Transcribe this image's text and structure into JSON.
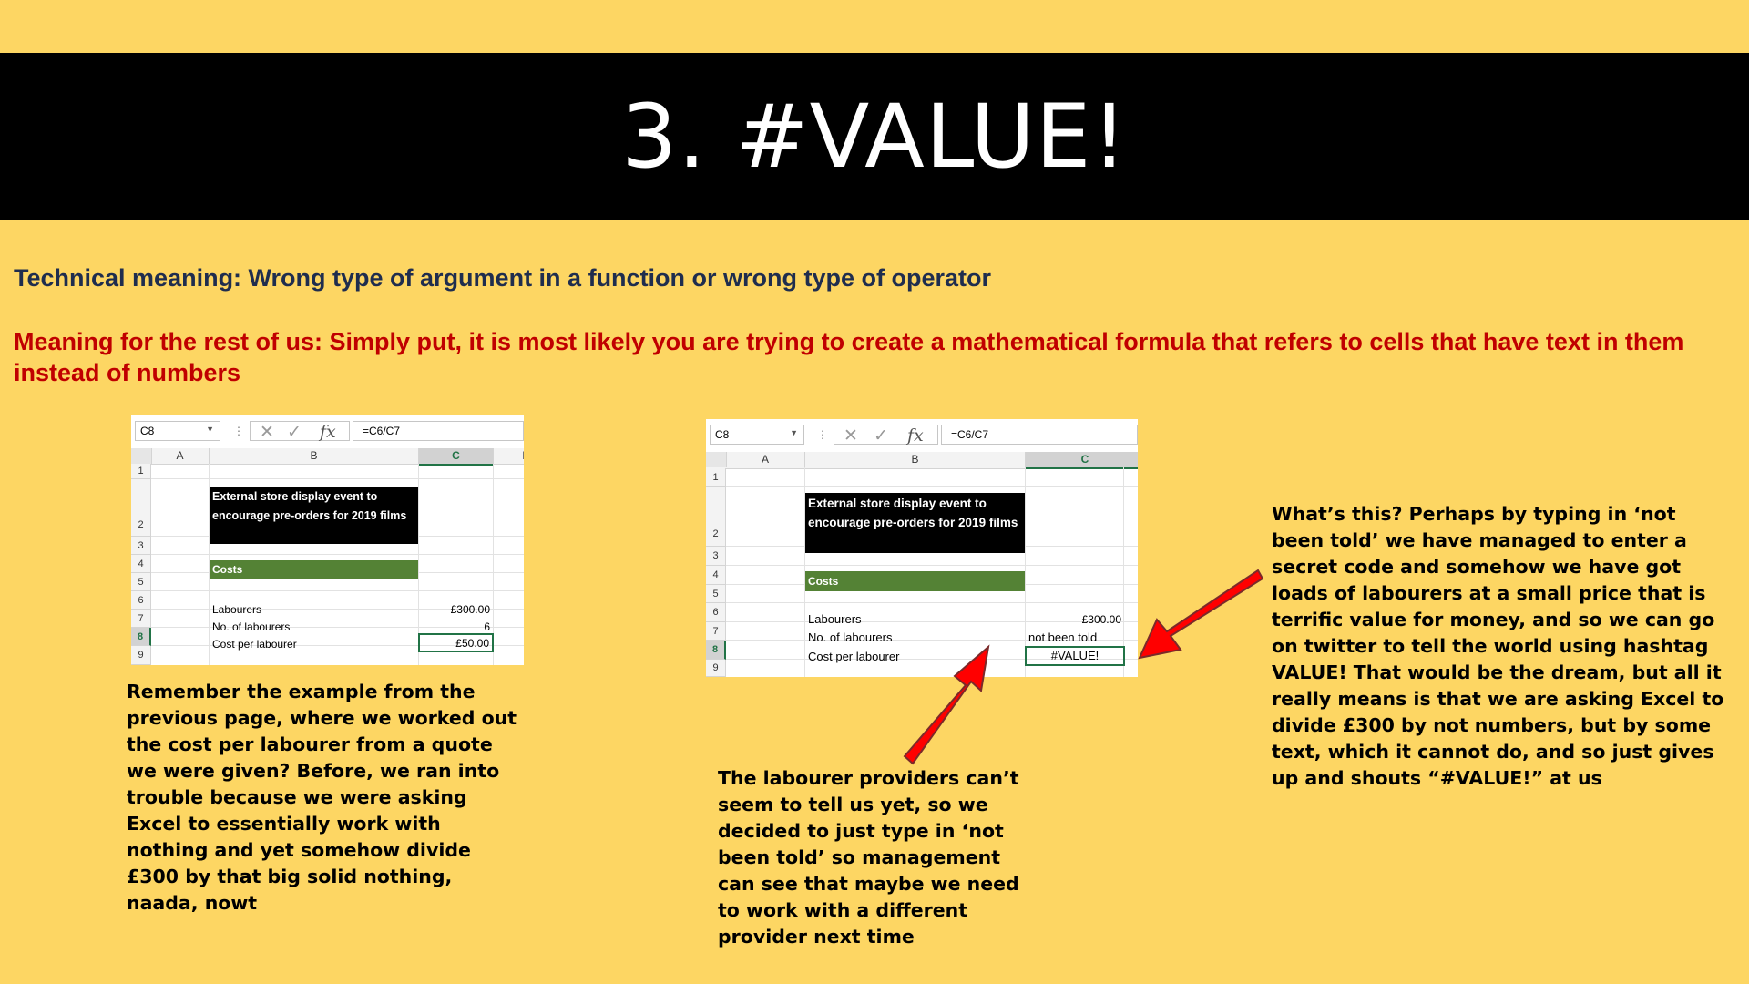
{
  "title": "3. #VALUE!",
  "technical_meaning": "Technical meaning: Wrong type of argument in a function or wrong type of operator",
  "rest_meaning": "Meaning for the rest of us: Simply put, it is most likely you are trying to create a mathematical formula that refers to cells that have text in them instead of numbers",
  "spreadsheet_left": {
    "name_box": "C8",
    "formula": "=C6/C7",
    "columns": [
      "A",
      "B",
      "C",
      "D"
    ],
    "rows": [
      "1",
      "2",
      "3",
      "4",
      "5",
      "6",
      "7",
      "8",
      "9"
    ],
    "title_cell": "External store display event to encourage pre-orders for 2019 films",
    "costs_label": "Costs",
    "labourers_label": "Labourers",
    "labourers_value": "£300.00",
    "num_labourers_label": "No. of labourers",
    "num_labourers_value": "6",
    "cost_per_label": "Cost per labourer",
    "cost_per_value": "£50.00"
  },
  "spreadsheet_right": {
    "name_box": "C8",
    "formula": "=C6/C7",
    "columns": [
      "A",
      "B",
      "C"
    ],
    "rows": [
      "1",
      "2",
      "3",
      "4",
      "5",
      "6",
      "7",
      "8",
      "9"
    ],
    "title_cell": "External store display event to encourage pre-orders for 2019 films",
    "costs_label": "Costs",
    "labourers_label": "Labourers",
    "labourers_value": "£300.00",
    "num_labourers_label": "No. of labourers",
    "num_labourers_value": "not been told",
    "cost_per_label": "Cost per labourer",
    "cost_per_value": "#VALUE!"
  },
  "text_left": "Remember the example from the previous page, where we worked out the cost per labourer from a quote we were given? Before, we ran into trouble because we were asking Excel to essentially work with nothing and yet somehow divide £300 by that big solid nothing, naada, nowt",
  "text_middle": "The labourer providers can’t seem to tell us yet, so we decided to just type in ‘not been told’ so management can see that maybe we need to work with a different provider next time",
  "text_right": "What’s this? Perhaps by typing in ‘not been told’ we have managed to enter a secret code and somehow we have got loads of labourers at a small price that is terrific value for money, and so we can go on twitter to tell the world using hashtag VALUE! That would be the dream, but all it really means is that we are asking Excel to divide £300 by not numbers, but by some text, which it cannot do, and so just gives up and shouts “#VALUE!” at us",
  "icons": {
    "cancel": "cross-icon",
    "enter": "check-icon",
    "function": "fx-icon",
    "arrow": "red-arrow-icon"
  },
  "colors": {
    "background": "#FDD663",
    "title_band": "#000000",
    "technical_text": "#1F2D4E",
    "rest_text": "#C00000",
    "costs_fill": "#548235",
    "excel_green": "#217346",
    "arrow": "#FF0000"
  }
}
